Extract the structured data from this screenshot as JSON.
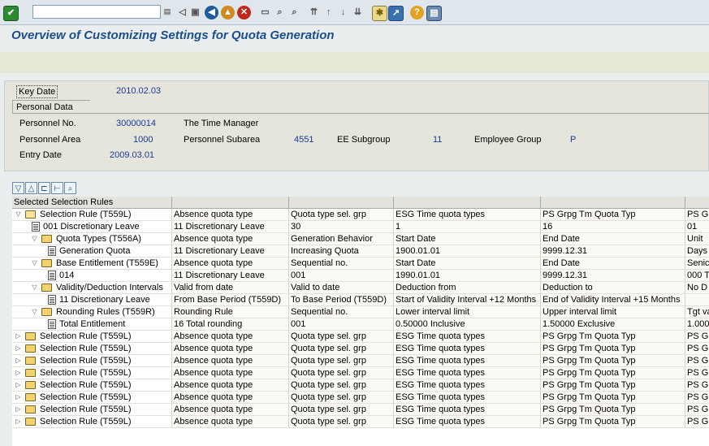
{
  "toolbar": {
    "command_field": "",
    "colors": {
      "ok": "#2d8a32",
      "back": "#1e5d99",
      "exit": "#d08a1f",
      "cancel": "#c0281e"
    }
  },
  "page_title": "Overview of Customizing Settings for Quota Generation",
  "key_date": {
    "label": "Key Date",
    "value": "2010.02.03"
  },
  "personal_data": {
    "tab_label": "Personal Data",
    "personnel_no_label": "Personnel No.",
    "personnel_no": "30000014",
    "name": "The Time Manager",
    "personnel_area_label": "Personnel Area",
    "personnel_area": "1000",
    "personnel_subarea_label": "Personnel Subarea",
    "personnel_subarea": "4551",
    "ee_subgroup_label": "EE Subgroup",
    "ee_subgroup": "11",
    "employee_group_label": "Employee Group",
    "employee_group": "P",
    "entry_date_label": "Entry Date",
    "entry_date": "2009.03.01"
  },
  "tree": {
    "columns": [
      "Selected Selection Rules",
      "",
      "",
      "",
      "",
      ""
    ],
    "rows": [
      {
        "level": 0,
        "expander": "open",
        "icon": "folder-open",
        "cells": [
          "Selection Rule (T559L)",
          "Absence quota type",
          "Quota type sel. grp",
          "ESG Time quota types",
          "PS Grpg Tm Quota Typ",
          "PS G"
        ]
      },
      {
        "level": 1,
        "expander": "",
        "icon": "doc",
        "cells": [
          "001 Discretionary Leave",
          "11 Discretionary Leave",
          "30",
          "1",
          "16",
          "01"
        ]
      },
      {
        "level": 1,
        "expander": "open",
        "icon": "folder",
        "cells": [
          "Quota Types (T556A)",
          "Absence quota type",
          "Generation Behavior",
          "Start Date",
          "End Date",
          "Unit"
        ]
      },
      {
        "level": 2,
        "expander": "",
        "icon": "doc",
        "cells": [
          "Generation Quota",
          "11 Discretionary Leave",
          "Increasing Quota",
          "1900.01.01",
          "9999.12.31",
          "Days"
        ]
      },
      {
        "level": 1,
        "expander": "open",
        "icon": "folder",
        "cells": [
          "Base Entitlement (T559E)",
          "Absence quota type",
          "Sequential no.",
          "Start Date",
          "End Date",
          "Senic"
        ]
      },
      {
        "level": 2,
        "expander": "",
        "icon": "doc",
        "cells": [
          "014",
          "11 Discretionary Leave",
          "001",
          "1990.01.01",
          "9999.12.31",
          "000 T"
        ]
      },
      {
        "level": 1,
        "expander": "open",
        "icon": "folder",
        "cells": [
          "Validity/Deduction Intervals",
          "Valid from date",
          "Valid to date",
          "Deduction from",
          "Deduction to",
          "No D"
        ]
      },
      {
        "level": 2,
        "expander": "",
        "icon": "doc",
        "cells": [
          "11 Discretionary Leave",
          "From Base Period (T559D)",
          "To Base Period (T559D)",
          "Start of Validity Interval +12 Months",
          "End of Validity Interval +15 Months",
          ""
        ]
      },
      {
        "level": 1,
        "expander": "open",
        "icon": "folder",
        "cells": [
          "Rounding Rules (T559R)",
          "Rounding Rule",
          "Sequential no.",
          "Lower interval limit",
          "Upper interval limit",
          "Tgt va"
        ]
      },
      {
        "level": 2,
        "expander": "",
        "icon": "doc",
        "cells": [
          "Total Entitlement",
          "16 Total rounding",
          "001",
          "0.50000 Inclusive",
          "1.50000 Exclusive",
          "1.000"
        ]
      },
      {
        "level": 0,
        "expander": "closed",
        "icon": "folder",
        "cells": [
          "Selection Rule (T559L)",
          "Absence quota type",
          "Quota type sel. grp",
          "ESG Time quota types",
          "PS Grpg Tm Quota Typ",
          "PS G"
        ]
      },
      {
        "level": 0,
        "expander": "closed",
        "icon": "folder",
        "cells": [
          "Selection Rule (T559L)",
          "Absence quota type",
          "Quota type sel. grp",
          "ESG Time quota types",
          "PS Grpg Tm Quota Typ",
          "PS G"
        ]
      },
      {
        "level": 0,
        "expander": "closed",
        "icon": "folder",
        "cells": [
          "Selection Rule (T559L)",
          "Absence quota type",
          "Quota type sel. grp",
          "ESG Time quota types",
          "PS Grpg Tm Quota Typ",
          "PS G"
        ]
      },
      {
        "level": 0,
        "expander": "closed",
        "icon": "folder",
        "cells": [
          "Selection Rule (T559L)",
          "Absence quota type",
          "Quota type sel. grp",
          "ESG Time quota types",
          "PS Grpg Tm Quota Typ",
          "PS G"
        ]
      },
      {
        "level": 0,
        "expander": "closed",
        "icon": "folder",
        "cells": [
          "Selection Rule (T559L)",
          "Absence quota type",
          "Quota type sel. grp",
          "ESG Time quota types",
          "PS Grpg Tm Quota Typ",
          "PS G"
        ]
      },
      {
        "level": 0,
        "expander": "closed",
        "icon": "folder",
        "cells": [
          "Selection Rule (T559L)",
          "Absence quota type",
          "Quota type sel. grp",
          "ESG Time quota types",
          "PS Grpg Tm Quota Typ",
          "PS G"
        ]
      },
      {
        "level": 0,
        "expander": "closed",
        "icon": "folder",
        "cells": [
          "Selection Rule (T559L)",
          "Absence quota type",
          "Quota type sel. grp",
          "ESG Time quota types",
          "PS Grpg Tm Quota Typ",
          "PS G"
        ]
      },
      {
        "level": 0,
        "expander": "closed",
        "icon": "folder",
        "cells": [
          "Selection Rule (T559L)",
          "Absence quota type",
          "Quota type sel. grp",
          "ESG Time quota types",
          "PS Grpg Tm Quota Typ",
          "PS G"
        ]
      }
    ]
  }
}
